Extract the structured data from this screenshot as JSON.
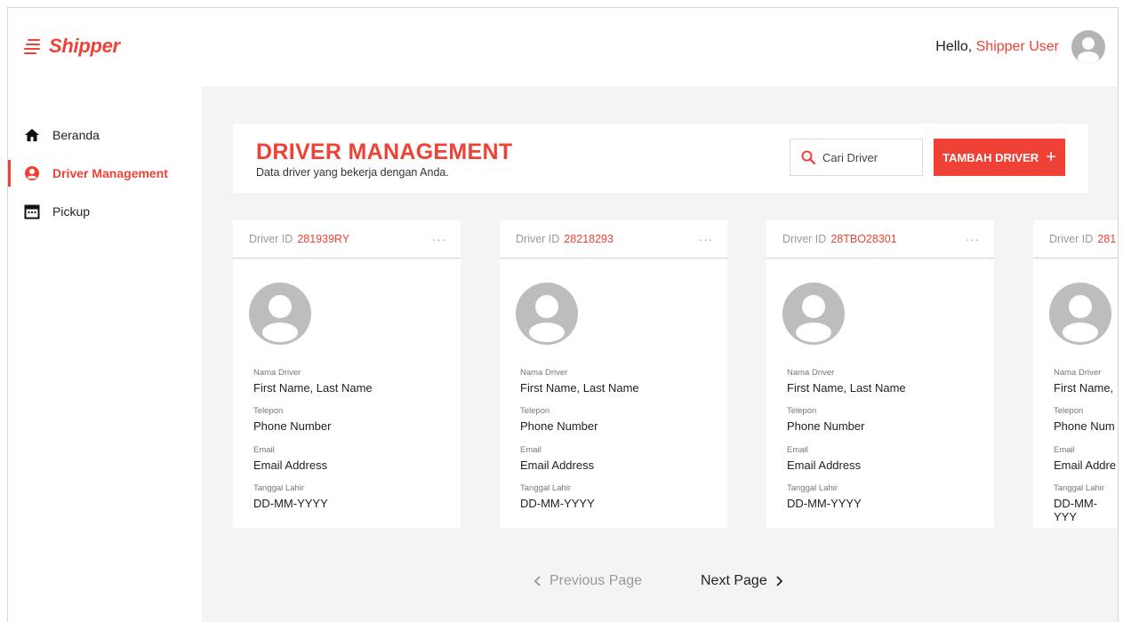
{
  "app": {
    "name": "Shipper"
  },
  "header": {
    "greeting": "Hello,",
    "user_name": "Shipper User"
  },
  "sidebar": {
    "items": [
      {
        "label": "Beranda",
        "icon": "home-icon",
        "active": false
      },
      {
        "label": "Driver Management",
        "icon": "user-circle-icon",
        "active": true
      },
      {
        "label": "Pickup",
        "icon": "calendar-icon",
        "active": false
      }
    ]
  },
  "page": {
    "title": "DRIVER MANAGEMENT",
    "subtitle": "Data driver yang bekerja dengan Anda.",
    "search_placeholder": "Cari Driver",
    "add_button_label": "TAMBAH DRIVER",
    "add_button_icon": "+"
  },
  "labels": {
    "driver_id": "Driver ID",
    "nama": "Nama Driver",
    "telepon": "Telepon",
    "email": "Email",
    "tanggal_lahir": "Tanggal Lahir",
    "more": "···"
  },
  "drivers": [
    {
      "id": "281939RY",
      "name": "First  Name, Last Name",
      "phone": "Phone Number",
      "email": "Email Address",
      "dob": "DD-MM-YYYY"
    },
    {
      "id": "28218293",
      "name": "First  Name, Last Name",
      "phone": "Phone Number",
      "email": "Email Address",
      "dob": "DD-MM-YYYY"
    },
    {
      "id": "28TBO28301",
      "name": "First  Name, Last Name",
      "phone": "Phone Number",
      "email": "Email Address",
      "dob": "DD-MM-YYYY"
    },
    {
      "id": "281",
      "name": "First  Name,",
      "phone": "Phone Num",
      "email": "Email Addre",
      "dob": "DD-MM-YYY"
    }
  ],
  "pagination": {
    "prev": "Previous Page",
    "next": "Next Page"
  },
  "colors": {
    "accent": "#ef4136",
    "background": "#f4f4f4",
    "avatar": "#bdbdbd"
  }
}
